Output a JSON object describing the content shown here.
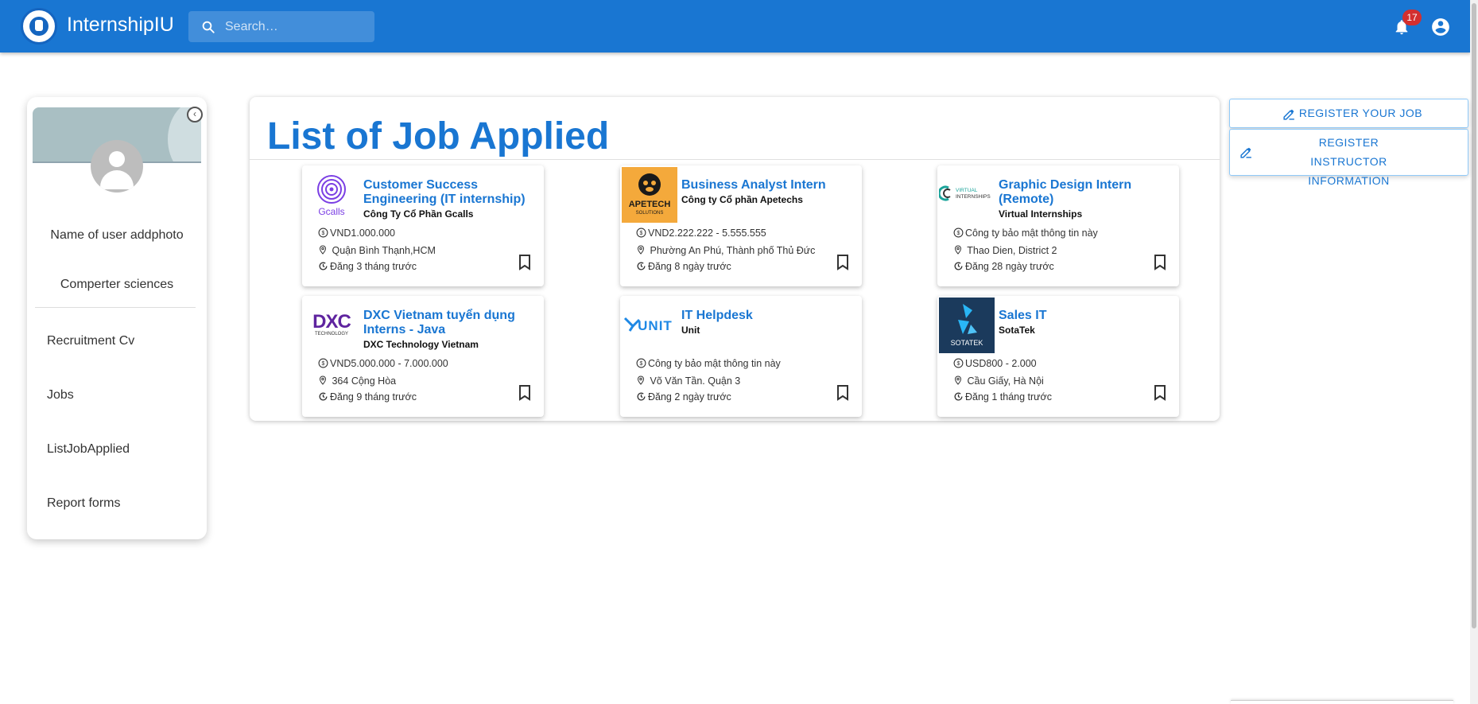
{
  "header": {
    "brand": "InternshipIU",
    "search_placeholder": "Search…",
    "notification_count": "17"
  },
  "profile": {
    "name": "Name of user addphoto",
    "major": "Comperter sciences",
    "nav": [
      "Recruitment Cv",
      "Jobs",
      "ListJobApplied",
      "Report forms"
    ]
  },
  "main": {
    "title": "List of Job Applied",
    "jobs": [
      {
        "title": "Customer Success Engineering (IT internship)",
        "company": "Công Ty Cổ Phần Gcalls",
        "salary": "VND1.000.000",
        "location": "Quận Bình Thạnh,HCM",
        "posted": "Đăng 3 tháng trước",
        "logo": "gcalls-logo"
      },
      {
        "title": "Business Analyst Intern",
        "company": "Công ty Cổ phần Apetechs",
        "salary": "VND2.222.222 - 5.555.555",
        "location": "Phường An Phú, Thành phố Thủ Đức",
        "posted": "Đăng 8 ngày trước",
        "logo": "apetech-logo",
        "logo_text": "APETECH",
        "logo_sub": "SOLUTIONS"
      },
      {
        "title": "Graphic Design Intern (Remote)",
        "company": "Virtual Internships",
        "salary": "Công ty bảo mật thông tin này",
        "location": "Thao Dien, District 2",
        "posted": "Đăng 28 ngày trước",
        "logo": "virtual-internships-logo",
        "logo_text": "VIRTUAL",
        "logo_sub": "INTERNSHIPS"
      },
      {
        "title": "DXC Vietnam tuyển dụng Interns - Java",
        "company": "DXC Technology Vietnam",
        "salary": "VND5.000.000 - 7.000.000",
        "location": "364 Cộng Hòa",
        "posted": "Đăng 9 tháng trước",
        "logo": "dxc-logo",
        "logo_text": "DXC",
        "logo_sub": "TECHNOLOGY"
      },
      {
        "title": "IT Helpdesk",
        "company": "Unit",
        "salary": "Công ty bảo mật thông tin này",
        "location": "Võ Văn Tần. Quận 3",
        "posted": "Đăng 2 ngày trước",
        "logo": "unit-logo",
        "logo_text": "UNIT"
      },
      {
        "title": "Sales IT",
        "company": "SotaTek",
        "salary": "USD800 - 2.000",
        "location": "Cầu Giấy, Hà Nội",
        "posted": "Đăng 1 tháng trước",
        "logo": "sotatek-logo",
        "logo_text": "SOTATEK"
      }
    ]
  },
  "actions": {
    "register_job": "REGISTER YOUR JOB",
    "register_instructor": "REGISTER INSTRUCTOR INFORMATION"
  },
  "colors": {
    "primary": "#1976d2",
    "badge": "#d32f2f",
    "apetech_bg": "#f4a93b",
    "dxc_purple": "#5f249f",
    "sotatek_bg": "#1b3a5c"
  },
  "icons": [
    "search-icon",
    "notifications-icon",
    "account-circle-icon",
    "chevron-left-icon",
    "dollar-icon",
    "location-icon",
    "clock-icon",
    "bookmark-icon",
    "edit-icon"
  ]
}
